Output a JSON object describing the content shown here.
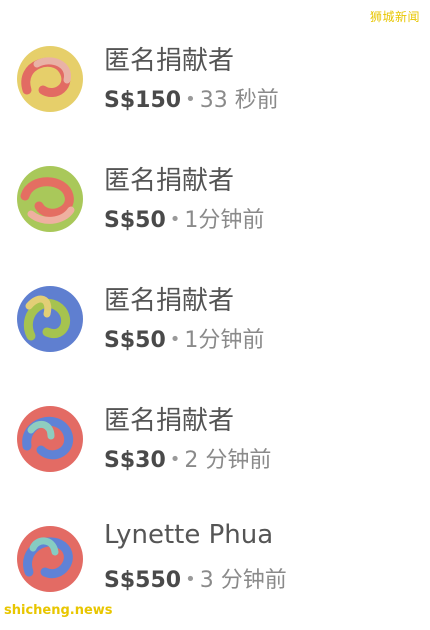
{
  "watermark": {
    "top": "狮城新闻",
    "bottom": "shicheng.news"
  },
  "donors": [
    {
      "name": "匿名捐献者",
      "amount": "S$150",
      "time": "33 秒前",
      "avatar_colors": [
        "#e6cf6a",
        "#e26b63",
        "#e9b2a6"
      ]
    },
    {
      "name": "匿名捐献者",
      "amount": "S$50",
      "time": "1分钟前",
      "avatar_colors": [
        "#a9c85a",
        "#e46e62",
        "#efb0a0"
      ]
    },
    {
      "name": "匿名捐献者",
      "amount": "S$50",
      "time": "1分钟前",
      "avatar_colors": [
        "#5f7fd0",
        "#a6c34f",
        "#e3ce76"
      ]
    },
    {
      "name": "匿名捐献者",
      "amount": "S$30",
      "time": "2 分钟前",
      "avatar_colors": [
        "#e36b64",
        "#5f82d6",
        "#8fcdbf"
      ]
    },
    {
      "name": "Lynette Phua",
      "amount": "S$550",
      "time": "3 分钟前",
      "avatar_colors": [
        "#e36b64",
        "#5f82d6",
        "#86ccc2"
      ]
    }
  ]
}
